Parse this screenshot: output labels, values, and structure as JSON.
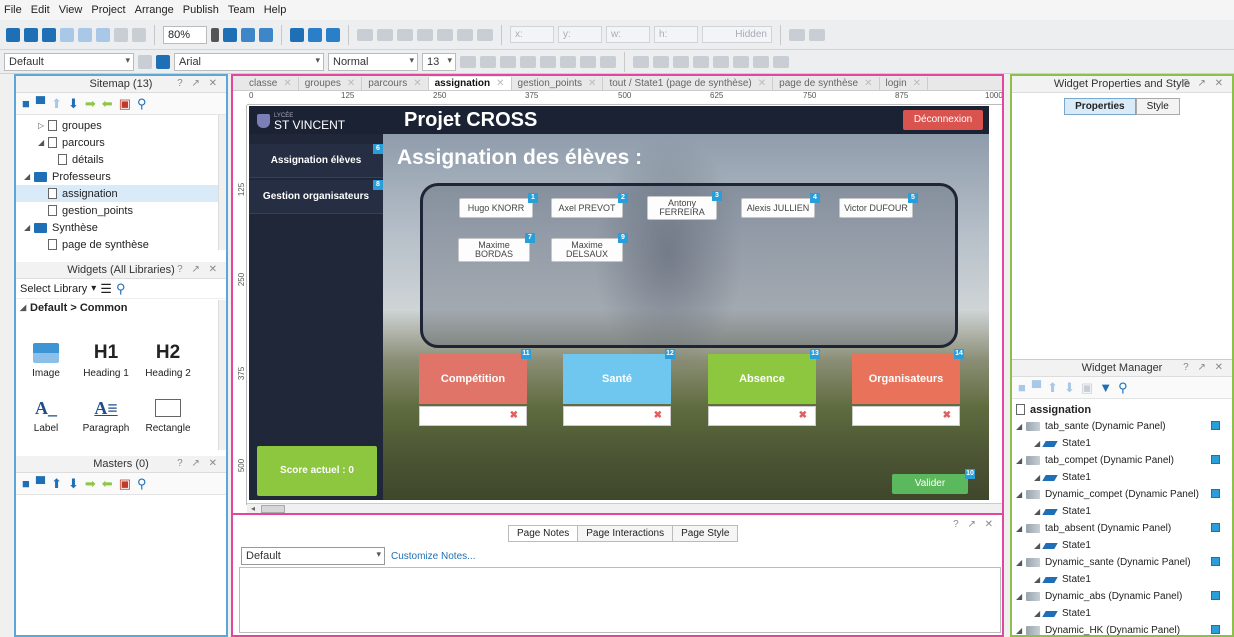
{
  "menu": [
    "File",
    "Edit",
    "View",
    "Project",
    "Arrange",
    "Publish",
    "Team",
    "Help"
  ],
  "toolbar": {
    "zoom": "80%",
    "style": "Default",
    "font": "Arial",
    "weight": "Normal",
    "size": "13",
    "x": "x:",
    "y": "y:",
    "w": "w:",
    "h": "h:",
    "hidden": "Hidden"
  },
  "sitemap": {
    "title": "Sitemap (13)",
    "items": [
      {
        "label": "groupes",
        "kind": "page"
      },
      {
        "label": "parcours",
        "kind": "page"
      },
      {
        "label": "détails",
        "kind": "page"
      },
      {
        "label": "Professeurs",
        "kind": "folder"
      },
      {
        "label": "assignation",
        "kind": "page"
      },
      {
        "label": "gestion_points",
        "kind": "page"
      },
      {
        "label": "Synthèse",
        "kind": "folder"
      },
      {
        "label": "page de synthèse",
        "kind": "page"
      }
    ]
  },
  "widgets_panel": {
    "title": "Widgets (All Libraries)",
    "select_library": "Select Library",
    "group": "Default > Common",
    "items": [
      "Image",
      "Heading 1",
      "Heading 2",
      "Label",
      "Paragraph",
      "Rectangle"
    ],
    "h1_glyph": "H1",
    "h2_glyph": "H2",
    "label_glyph": "A_",
    "para_glyph": "A≡"
  },
  "masters": {
    "title": "Masters (0)"
  },
  "tabs": [
    "classe",
    "groupes",
    "parcours",
    "assignation",
    "gestion_points",
    "tout / State1 (page de synthèse)",
    "page de synthèse",
    "login"
  ],
  "ruler_h": [
    "0",
    "125",
    "250",
    "375",
    "500",
    "625",
    "750",
    "875",
    "1000"
  ],
  "ruler_v": [
    "125",
    "250",
    "375",
    "500"
  ],
  "prototype": {
    "logo_small": "LYCÉE",
    "logo": "ST VINCENT",
    "project_title": "Projet CROSS",
    "logout": "Déconnexion",
    "nav": [
      {
        "label": "Assignation élèves",
        "badge": "6"
      },
      {
        "label": "Gestion organisateurs",
        "badge": "8"
      }
    ],
    "section_title": "Assignation des élèves :",
    "students": [
      {
        "name": "Hugo KNORR",
        "badge": "1"
      },
      {
        "name": "Axel PREVOT",
        "badge": "2"
      },
      {
        "name": "Antony FERREIRA",
        "badge": "3"
      },
      {
        "name": "Alexis JULLIEN",
        "badge": "4"
      },
      {
        "name": "Victor DUFOUR",
        "badge": "5"
      },
      {
        "name": "Maxime BORDAS",
        "badge": "7"
      },
      {
        "name": "Maxime DELSAUX",
        "badge": "9"
      }
    ],
    "cards": [
      {
        "label": "Compétition",
        "badge": "11",
        "color": "#e07468"
      },
      {
        "label": "Santé",
        "badge": "12",
        "color": "#6fc7ef"
      },
      {
        "label": "Absence",
        "badge": "13",
        "color": "#8dc63f"
      },
      {
        "label": "Organisateurs",
        "badge": "14",
        "color": "#e8725a"
      }
    ],
    "delete_glyph": "✖",
    "score": "Score actuel : 0",
    "validate": "Valider",
    "validate_badge": "10"
  },
  "notes": {
    "tabs": [
      "Page Notes",
      "Page Interactions",
      "Page Style"
    ],
    "select": "Default",
    "customize": "Customize Notes..."
  },
  "props": {
    "title": "Widget Properties and Style",
    "tabs": [
      "Properties",
      "Style"
    ]
  },
  "widget_manager": {
    "title": "Widget Manager",
    "root": "assignation",
    "items": [
      {
        "label": "tab_sante (Dynamic Panel)",
        "state": "State1"
      },
      {
        "label": "tab_compet (Dynamic Panel)",
        "state": "State1"
      },
      {
        "label": "Dynamic_compet (Dynamic Panel)",
        "state": "State1"
      },
      {
        "label": "tab_absent (Dynamic Panel)",
        "state": "State1"
      },
      {
        "label": "Dynamic_sante (Dynamic Panel)",
        "state": "State1"
      },
      {
        "label": "Dynamic_abs (Dynamic Panel)",
        "state": "State1"
      },
      {
        "label": "Dynamic_HK (Dynamic Panel)",
        "state": ""
      }
    ]
  }
}
